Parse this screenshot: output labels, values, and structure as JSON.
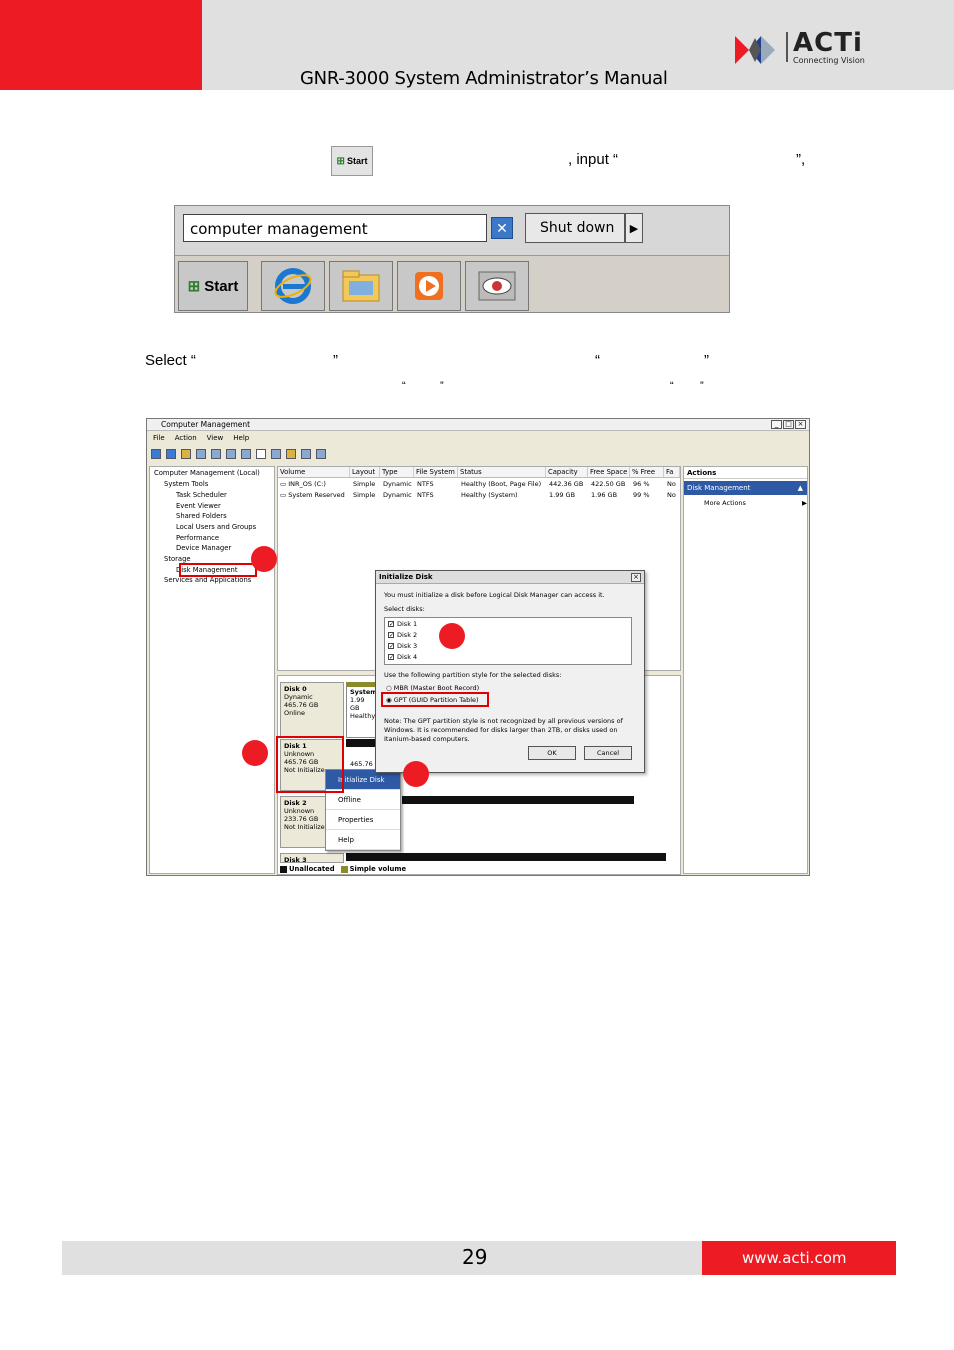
{
  "header": {
    "title": "GNR-3000 System Administrator’s Manual",
    "logo_text": "ACTi",
    "logo_tagline": "Connecting Vision",
    "red": "#ed1c24"
  },
  "body": {
    "line1_mid": ", input “",
    "line1_end": "”,",
    "start_small": "Start",
    "select_prefix": "Select “",
    "close_quote": "”",
    "open_quote": "“"
  },
  "taskbar_shot": {
    "search_value": "computer management",
    "clear_icon": "x-icon",
    "shutdown_label": "Shut down",
    "start_label": "Start"
  },
  "cm_shot": {
    "window_title": "Computer Management",
    "menu": [
      "File",
      "Action",
      "View",
      "Help"
    ],
    "tree": [
      "Computer Management (Local)",
      "System Tools",
      "Task Scheduler",
      "Event Viewer",
      "Shared Folders",
      "Local Users and Groups",
      "Performance",
      "Device Manager",
      "Storage",
      "Disk Management",
      "Services and Applications"
    ],
    "columns": [
      "Volume",
      "Layout",
      "Type",
      "File System",
      "Status",
      "Capacity",
      "Free Space",
      "% Free",
      "Fa"
    ],
    "rows": [
      [
        "INR_OS (C:)",
        "Simple",
        "Dynamic",
        "NTFS",
        "Healthy (Boot, Page File)",
        "442.36 GB",
        "422.50 GB",
        "96 %",
        "No"
      ],
      [
        "System Reserved",
        "Simple",
        "Dynamic",
        "NTFS",
        "Healthy (System)",
        "1.99 GB",
        "1.96 GB",
        "99 %",
        "No"
      ]
    ],
    "actions_header": "Actions",
    "actions_selected": "Disk Management",
    "actions_more": "More Actions",
    "disks": {
      "d0": [
        "Disk 0",
        "Dynamic",
        "465.76 GB",
        "Online"
      ],
      "d0_vol": [
        "System",
        "1.99 GB",
        "Healthy"
      ],
      "d1": [
        "Disk 1",
        "Unknown",
        "465.76 GB",
        "Not Initialize"
      ],
      "d1_vol": "465.76",
      "d2": [
        "Disk 2",
        "Unknown",
        "233.76 GB",
        "Not Initialize"
      ],
      "d3": "Disk 3"
    },
    "legend": [
      "Unallocated",
      "Simple volume"
    ],
    "context_menu": [
      "Initialize Disk",
      "Offline",
      "Properties",
      "Help"
    ],
    "dialog": {
      "title": "Initialize Disk",
      "intro": "You must initialize a disk before Logical Disk Manager can access it.",
      "select_label": "Select disks:",
      "disks": [
        "Disk 1",
        "Disk 2",
        "Disk 3",
        "Disk 4"
      ],
      "style_label": "Use the following partition style for the selected disks:",
      "opt_mbr": "MBR (Master Boot Record)",
      "opt_gpt": "GPT (GUID Partition Table)",
      "note1": "Note: The GPT partition style is not recognized by all previous versions of",
      "note2": "Windows. It is recommended for disks larger than 2TB, or disks used on",
      "note3": "Itanium-based computers.",
      "ok": "OK",
      "cancel": "Cancel"
    }
  },
  "footer": {
    "page_number": "29",
    "url": "www.acti.com"
  }
}
